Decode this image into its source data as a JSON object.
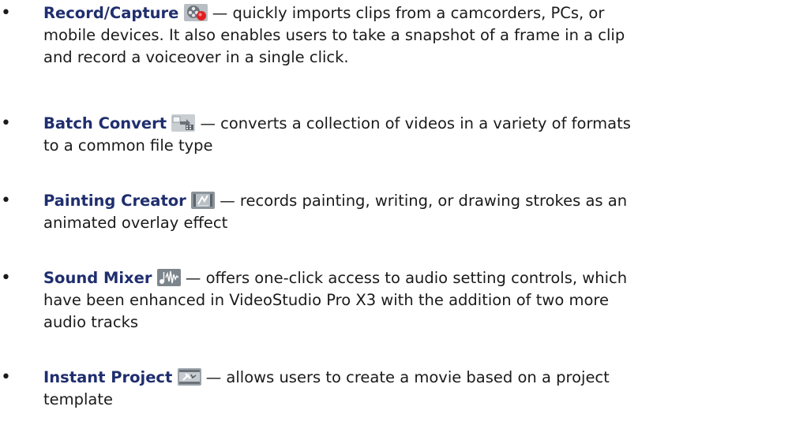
{
  "features": [
    {
      "name": "Record/Capture",
      "icon": "film-reel-record-icon",
      "desc_line1": "— quickly imports clips from a camcorders, PCs, or",
      "desc_rest": [
        "mobile devices. It also enables users to take a snapshot of a frame in a clip",
        "and record a voiceover in a single click."
      ]
    },
    {
      "name": "Batch Convert",
      "icon": "batch-convert-icon",
      "desc_line1": "— converts a collection of videos in a variety of formats",
      "desc_rest": [
        "to a common file type"
      ]
    },
    {
      "name": "Painting Creator",
      "icon": "painting-creator-icon",
      "desc_line1": "— records painting, writing, or drawing strokes as an",
      "desc_rest": [
        "animated overlay effect"
      ]
    },
    {
      "name": "Sound Mixer",
      "icon": "sound-mixer-icon",
      "desc_line1": "— offers one-click access to audio setting controls, which",
      "desc_rest": [
        "have been enhanced in VideoStudio Pro X3 with the addition of two more",
        "audio tracks"
      ]
    },
    {
      "name": "Instant Project",
      "icon": "instant-project-icon",
      "desc_line1": "— allows users to create a movie based on a project",
      "desc_rest": [
        "template"
      ]
    }
  ],
  "colors": {
    "heading": "#1f2e6e",
    "text": "#1a1a1a"
  }
}
